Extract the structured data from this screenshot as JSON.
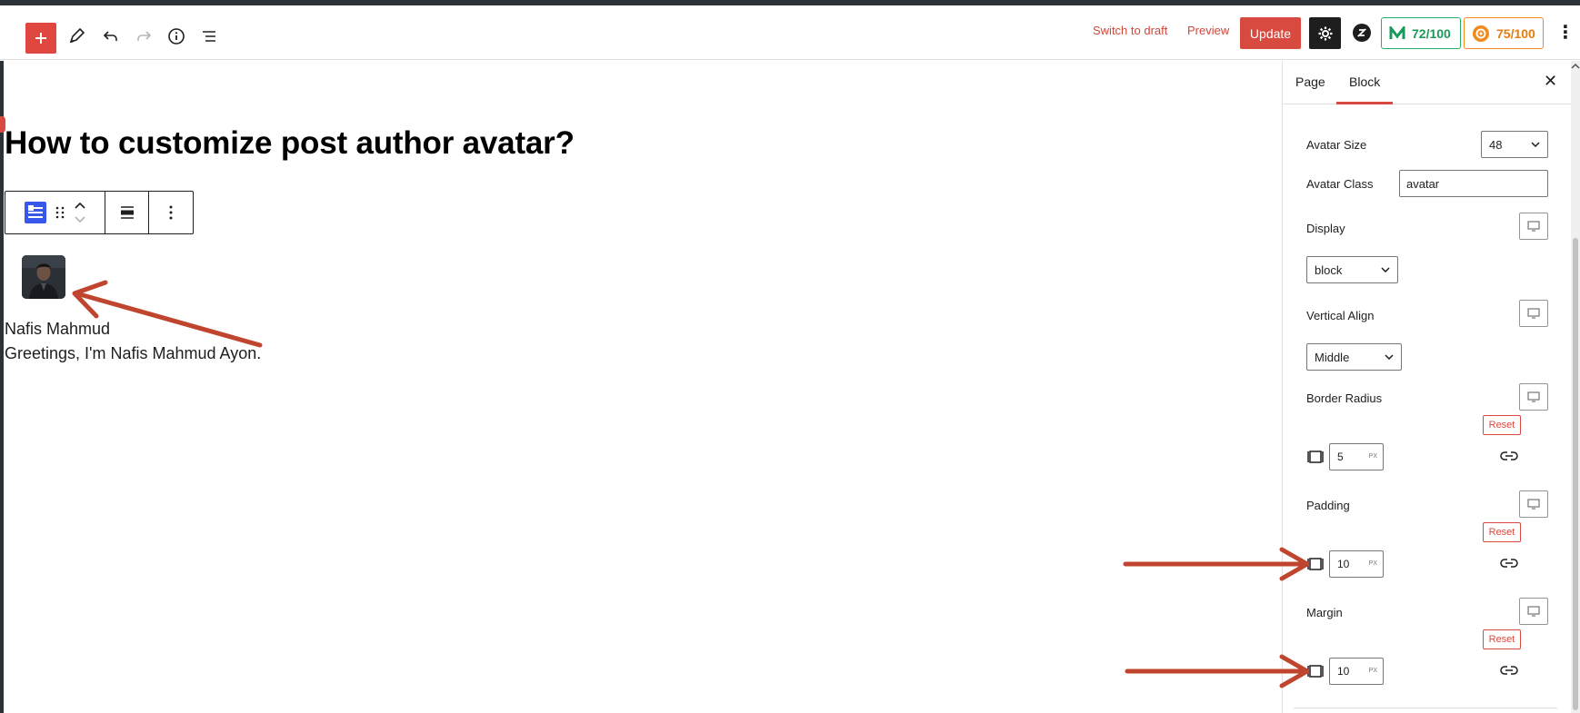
{
  "toolbar": {
    "add_icon": "plus-icon",
    "switch_to_draft": "Switch to draft",
    "preview": "Preview",
    "update": "Update",
    "seo_score": "72/100",
    "readability_score": "75/100",
    "colors": {
      "accent": "#d84a3f",
      "seo_green": "#1fb36b",
      "readability_orange": "#f28a1b"
    }
  },
  "editor": {
    "title": "How to customize post author avatar?",
    "author_name": "Nafis Mahmud",
    "author_bio": "Greetings, I'm Nafis Mahmud Ayon."
  },
  "sidebar": {
    "tabs": [
      {
        "label": "Page"
      },
      {
        "label": "Block"
      }
    ],
    "active_tab": "Block",
    "avatar_size": {
      "label": "Avatar Size",
      "value": "48"
    },
    "avatar_class": {
      "label": "Avatar Class",
      "value": "avatar"
    },
    "display": {
      "label": "Display",
      "value": "block"
    },
    "vertical_align": {
      "label": "Vertical Align",
      "value": "Middle"
    },
    "border_radius": {
      "label": "Border Radius",
      "reset": "Reset",
      "value": "5",
      "unit": "PX"
    },
    "padding": {
      "label": "Padding",
      "reset": "Reset",
      "value": "10",
      "unit": "PX"
    },
    "margin": {
      "label": "Margin",
      "reset": "Reset",
      "value": "10",
      "unit": "PX"
    }
  }
}
